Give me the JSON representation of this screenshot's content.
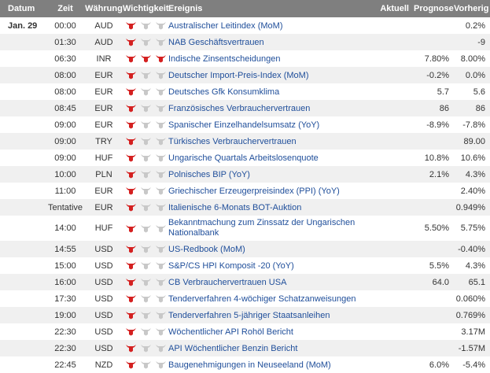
{
  "header": {
    "date": "Datum",
    "time": "Zeit",
    "currency": "Währung",
    "importance": "Wichtigkeit",
    "event": "Ereignis",
    "actual": "Aktuell",
    "forecast": "Prognose",
    "previous": "Vorherig"
  },
  "colors": {
    "bull_active": "#d42020",
    "bull_inactive": "#c8c8c8",
    "link": "#1f4e9a",
    "header_bg": "#7f7f7f"
  },
  "rows": [
    {
      "date": "Jan. 29",
      "time": "00:00",
      "currency": "AUD",
      "importance": 1,
      "event": "Australischer Leitindex (MoM)",
      "actual": "",
      "forecast": "",
      "previous": "0.2%"
    },
    {
      "date": "",
      "time": "01:30",
      "currency": "AUD",
      "importance": 1,
      "event": "NAB Geschäftsvertrauen",
      "actual": "",
      "forecast": "",
      "previous": "-9"
    },
    {
      "date": "",
      "time": "06:30",
      "currency": "INR",
      "importance": 3,
      "event": "Indische Zinsentscheidungen",
      "actual": "",
      "forecast": "7.80%",
      "previous": "8.00%"
    },
    {
      "date": "",
      "time": "08:00",
      "currency": "EUR",
      "importance": 1,
      "event": "Deutscher Import-Preis-Index (MoM)",
      "actual": "",
      "forecast": "-0.2%",
      "previous": "0.0%"
    },
    {
      "date": "",
      "time": "08:00",
      "currency": "EUR",
      "importance": 1,
      "event": "Deutsches Gfk Konsumklima",
      "actual": "",
      "forecast": "5.7",
      "previous": "5.6"
    },
    {
      "date": "",
      "time": "08:45",
      "currency": "EUR",
      "importance": 1,
      "event": "Französisches Verbrauchervertrauen",
      "actual": "",
      "forecast": "86",
      "previous": "86"
    },
    {
      "date": "",
      "time": "09:00",
      "currency": "EUR",
      "importance": 1,
      "event": "Spanischer Einzelhandelsumsatz (YoY)",
      "actual": "",
      "forecast": "-8.9%",
      "previous": "-7.8%"
    },
    {
      "date": "",
      "time": "09:00",
      "currency": "TRY",
      "importance": 1,
      "event": "Türkisches Verbrauchervertrauen",
      "actual": "",
      "forecast": "",
      "previous": "89.00"
    },
    {
      "date": "",
      "time": "09:00",
      "currency": "HUF",
      "importance": 1,
      "event": "Ungarische Quartals Arbeitslosenquote",
      "actual": "",
      "forecast": "10.8%",
      "previous": "10.6%"
    },
    {
      "date": "",
      "time": "10:00",
      "currency": "PLN",
      "importance": 1,
      "event": "Polnisches BIP (YoY)",
      "actual": "",
      "forecast": "2.1%",
      "previous": "4.3%"
    },
    {
      "date": "",
      "time": "11:00",
      "currency": "EUR",
      "importance": 1,
      "event": "Griechischer Erzeugerpreisindex (PPI) (YoY)",
      "actual": "",
      "forecast": "",
      "previous": "2.40%"
    },
    {
      "date": "",
      "time": "Tentative",
      "currency": "EUR",
      "importance": 1,
      "event": "Italienische 6-Monats BOT-Auktion",
      "actual": "",
      "forecast": "",
      "previous": "0.949%"
    },
    {
      "date": "",
      "time": "14:00",
      "currency": "HUF",
      "importance": 1,
      "event": "Bekanntmachung zum Zinssatz der Ungarischen Nationalbank",
      "actual": "",
      "forecast": "5.50%",
      "previous": "5.75%"
    },
    {
      "date": "",
      "time": "14:55",
      "currency": "USD",
      "importance": 1,
      "event": "US-Redbook (MoM)",
      "actual": "",
      "forecast": "",
      "previous": "-0.40%"
    },
    {
      "date": "",
      "time": "15:00",
      "currency": "USD",
      "importance": 1,
      "event": "S&P/CS HPI Komposit -20 (YoY)",
      "actual": "",
      "forecast": "5.5%",
      "previous": "4.3%"
    },
    {
      "date": "",
      "time": "16:00",
      "currency": "USD",
      "importance": 1,
      "event": "CB Verbrauchervertrauen USA",
      "actual": "",
      "forecast": "64.0",
      "previous": "65.1"
    },
    {
      "date": "",
      "time": "17:30",
      "currency": "USD",
      "importance": 1,
      "event": "Tenderverfahren 4-wöchiger Schatzanweisungen",
      "actual": "",
      "forecast": "",
      "previous": "0.060%"
    },
    {
      "date": "",
      "time": "19:00",
      "currency": "USD",
      "importance": 1,
      "event": "Tenderverfahren 5-jähriger Staatsanleihen",
      "actual": "",
      "forecast": "",
      "previous": "0.769%"
    },
    {
      "date": "",
      "time": "22:30",
      "currency": "USD",
      "importance": 1,
      "event": "Wöchentlicher API Rohöl Bericht",
      "actual": "",
      "forecast": "",
      "previous": "3.17M"
    },
    {
      "date": "",
      "time": "22:30",
      "currency": "USD",
      "importance": 1,
      "event": "API Wöchentlicher Benzin Bericht",
      "actual": "",
      "forecast": "",
      "previous": "-1.57M"
    },
    {
      "date": "",
      "time": "22:45",
      "currency": "NZD",
      "importance": 1,
      "event": "Baugenehmigungen in Neuseeland (MoM)",
      "actual": "",
      "forecast": "6.0%",
      "previous": "-5.4%"
    }
  ]
}
